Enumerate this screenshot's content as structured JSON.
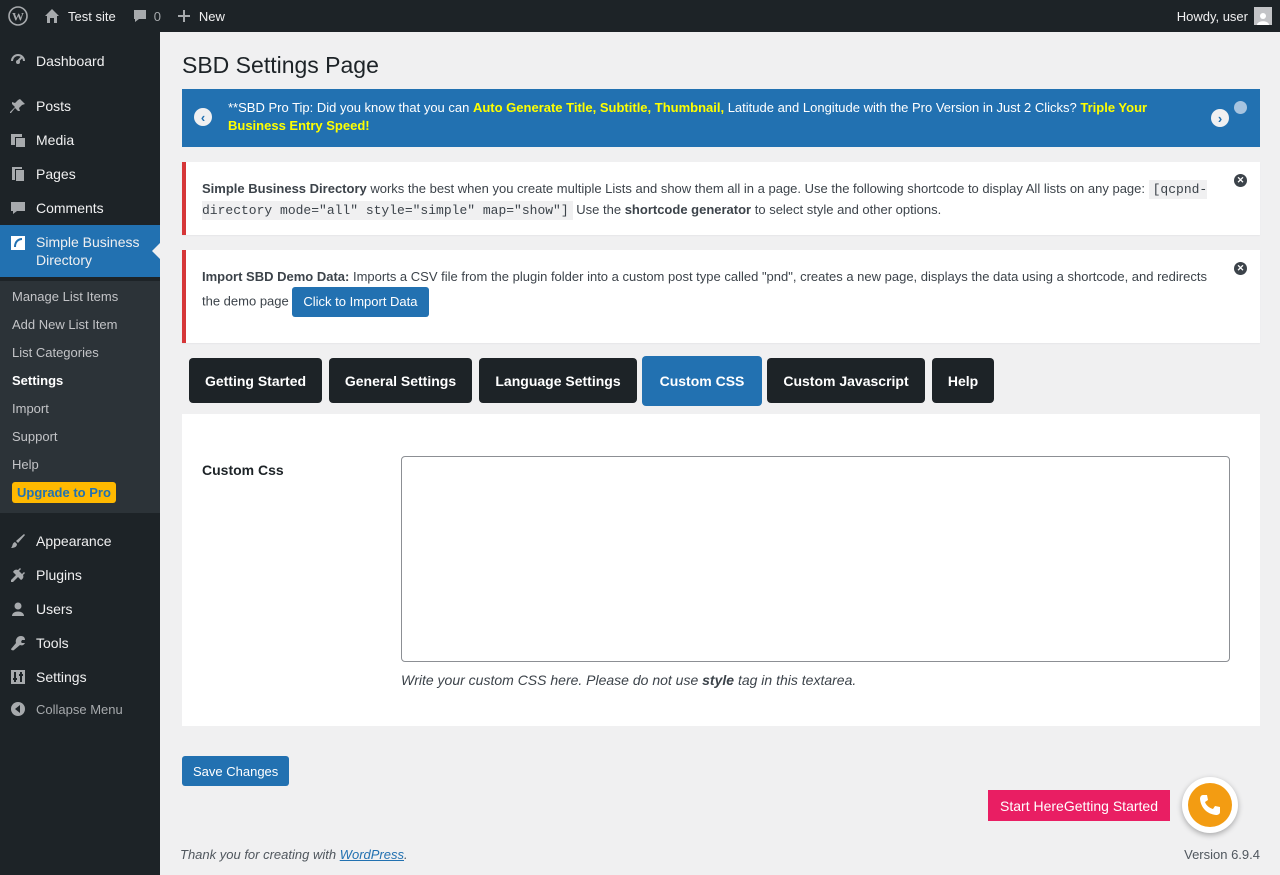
{
  "admin_bar": {
    "site_name": "Test site",
    "comments_count": "0",
    "new_label": "New",
    "greeting": "Howdy, user"
  },
  "sidebar": {
    "items": [
      {
        "label": "Dashboard",
        "icon": "dashboard-icon"
      },
      {
        "label": "Posts",
        "icon": "pin-icon"
      },
      {
        "label": "Media",
        "icon": "media-icon"
      },
      {
        "label": "Pages",
        "icon": "pages-icon"
      },
      {
        "label": "Comments",
        "icon": "comment-icon"
      },
      {
        "label": "Simple Business Directory",
        "icon": "directory-icon"
      },
      {
        "label": "Appearance",
        "icon": "brush-icon"
      },
      {
        "label": "Plugins",
        "icon": "plug-icon"
      },
      {
        "label": "Users",
        "icon": "user-icon"
      },
      {
        "label": "Tools",
        "icon": "wrench-icon"
      },
      {
        "label": "Settings",
        "icon": "sliders-icon"
      }
    ],
    "submenu": [
      "Manage List Items",
      "Add New List Item",
      "List Categories",
      "Settings",
      "Import",
      "Support",
      "Help"
    ],
    "upgrade_label": "Upgrade to Pro",
    "collapse_label": "Collapse Menu"
  },
  "page": {
    "title": "SBD Settings Page"
  },
  "pro_tip": {
    "prefix": "**SBD Pro Tip: Did you know that you can ",
    "highlight1": "Auto Generate Title, Subtitle, Thumbnail,",
    "middle": " Latitude and Longitude with the Pro Version in Just 2 Clicks? ",
    "highlight2": "Triple Your Business Entry Speed!"
  },
  "notice1": {
    "bold": "Simple Business Directory",
    "text1": " works the best when you create multiple Lists and show them all in a page. Use the following shortcode to display All lists on any page: ",
    "code": "[qcpnd-directory mode=\"all\" style=\"simple\" map=\"show\"]",
    "text2": " Use the ",
    "bold2": "shortcode generator",
    "text3": " to select style and other options."
  },
  "notice2": {
    "bold": "Import SBD Demo Data:",
    "text": " Imports a CSV file from the plugin folder into a custom post type called \"pnd\", creates a new page, displays the data using a shortcode, and redirects the demo page ",
    "button": "Click to Import Data"
  },
  "tabs": [
    "Getting Started",
    "General Settings",
    "Language Settings",
    "Custom CSS",
    "Custom Javascript",
    "Help"
  ],
  "active_tab": "Custom CSS",
  "form": {
    "label": "Custom Css",
    "value": "",
    "desc_prefix": "Write your custom CSS here. Please do not use ",
    "desc_bold": "style",
    "desc_suffix": " tag in this textarea."
  },
  "save_label": "Save Changes",
  "start_here_label": "Start HereGetting Started",
  "footer": {
    "thanks_prefix": "Thank you for creating with ",
    "link": "WordPress",
    "thanks_suffix": ".",
    "version": "Version 6.9.4"
  },
  "colors": {
    "admin_dark": "#1d2327",
    "accent": "#2271b1",
    "notice_border": "#d63638",
    "highlight": "#ffff00",
    "start_here": "#e91e63",
    "upgrade_bg": "#ffb900"
  }
}
